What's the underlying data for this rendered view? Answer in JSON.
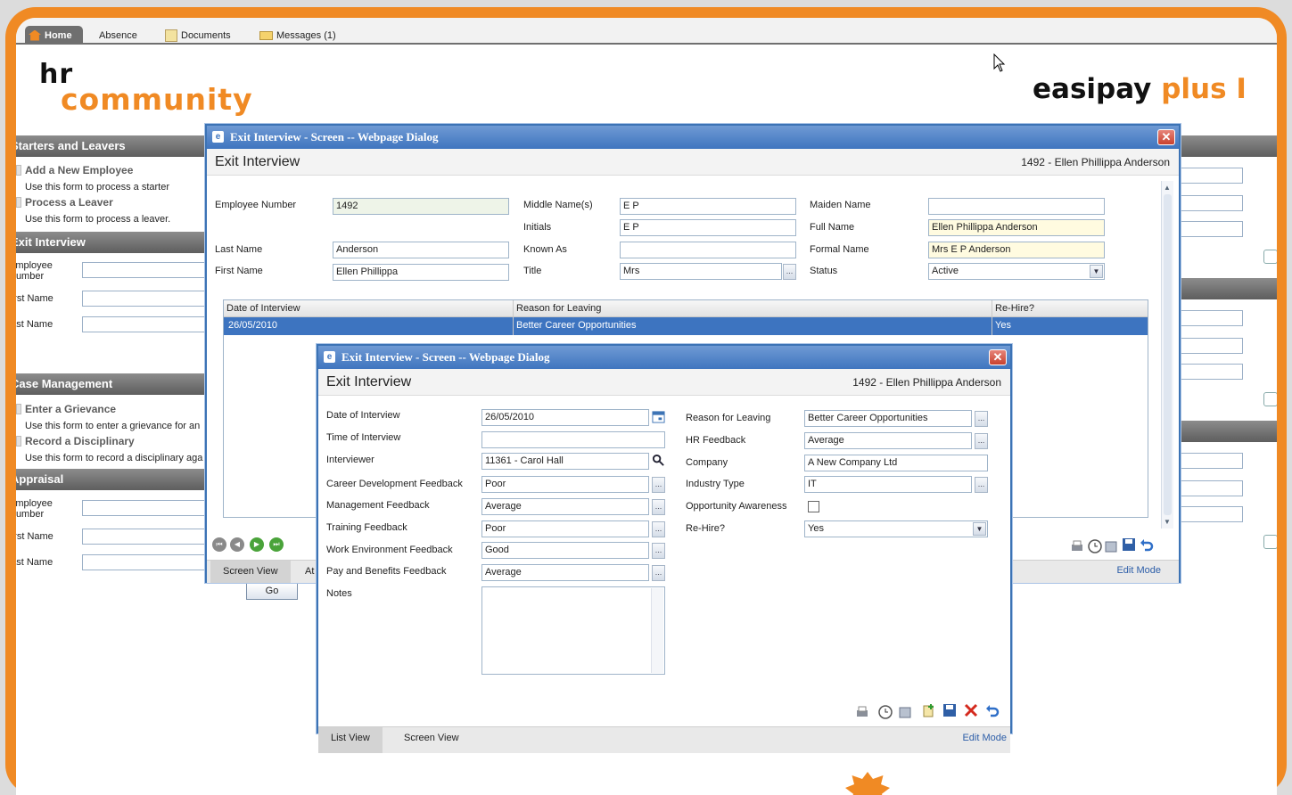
{
  "nav": {
    "home": "Home",
    "absence": "Absence",
    "documents": "Documents",
    "messages": "Messages (1)"
  },
  "logo": {
    "hr": "hr",
    "community": "community"
  },
  "brand": {
    "easipay": "easipay",
    "plus": "plus",
    "trail": "I"
  },
  "bg": {
    "starters_title": "Starters and Leavers",
    "add_employee": "Add a New Employee",
    "add_employee_desc": "Use this form to process a starter",
    "process_leaver": "Process a Leaver",
    "process_leaver_desc": "Use this form to process a leaver.",
    "exit_title": "Exit Interview",
    "employee_number": "Employee Number",
    "first_name": "First Name",
    "last_name": "Last Name",
    "case_title": "Case Management",
    "grievance": "Enter a Grievance",
    "grievance_desc": "Use this form to enter a grievance for an",
    "disciplinary": "Record a Disciplinary",
    "disciplinary_desc": "Use this form to record a disciplinary aga",
    "appraisal_title": "Appraisal",
    "go": "Go"
  },
  "dialog1": {
    "window_title": "Exit Interview - Screen -- Webpage Dialog",
    "heading": "Exit Interview",
    "record": "1492 - Ellen Phillippa Anderson",
    "labels": {
      "employee_number": "Employee Number",
      "last_name": "Last Name",
      "first_name": "First Name",
      "middle_names": "Middle Name(s)",
      "initials": "Initials",
      "known_as": "Known As",
      "title": "Title",
      "maiden_name": "Maiden Name",
      "full_name": "Full Name",
      "formal_name": "Formal Name",
      "status": "Status"
    },
    "values": {
      "employee_number": "1492",
      "last_name": "Anderson",
      "first_name": "Ellen Phillippa",
      "middle_names": "E P",
      "initials": "E P",
      "known_as": "",
      "title": "Mrs",
      "maiden_name": "",
      "full_name": "Ellen Phillippa Anderson",
      "formal_name": "Mrs E P Anderson",
      "status": "Active"
    },
    "grid": {
      "headers": [
        "Date of Interview",
        "Reason for Leaving",
        "Re-Hire?"
      ],
      "row": [
        "26/05/2010",
        "Better Career Opportunities",
        "Yes"
      ]
    },
    "tabs": [
      "Screen View",
      "At"
    ],
    "edit_mode": "Edit Mode"
  },
  "dialog2": {
    "window_title": "Exit Interview - Screen -- Webpage Dialog",
    "heading": "Exit Interview",
    "record": "1492 - Ellen Phillippa Anderson",
    "labels": {
      "date": "Date of Interview",
      "time": "Time of Interview",
      "interviewer": "Interviewer",
      "career": "Career Development Feedback",
      "management": "Management Feedback",
      "training": "Training Feedback",
      "work_env": "Work Environment Feedback",
      "pay": "Pay and Benefits Feedback",
      "notes": "Notes",
      "reason": "Reason for Leaving",
      "hr_feedback": "HR Feedback",
      "company": "Company",
      "industry": "Industry Type",
      "opportunity": "Opportunity Awareness",
      "rehire": "Re-Hire?"
    },
    "values": {
      "date": "26/05/2010",
      "time": "",
      "interviewer": "11361 - Carol Hall",
      "career": "Poor",
      "management": "Average",
      "training": "Poor",
      "work_env": "Good",
      "pay": "Average",
      "reason": "Better Career Opportunities",
      "hr_feedback": "Average",
      "company": "A New Company Ltd",
      "industry": "IT",
      "rehire": "Yes"
    },
    "tabs": [
      "List View",
      "Screen View"
    ],
    "edit_mode": "Edit Mode"
  },
  "colors": {
    "brand_orange": "#f08a24",
    "dialog_blue": "#3c73b5",
    "selected_row": "#3d74c0"
  }
}
